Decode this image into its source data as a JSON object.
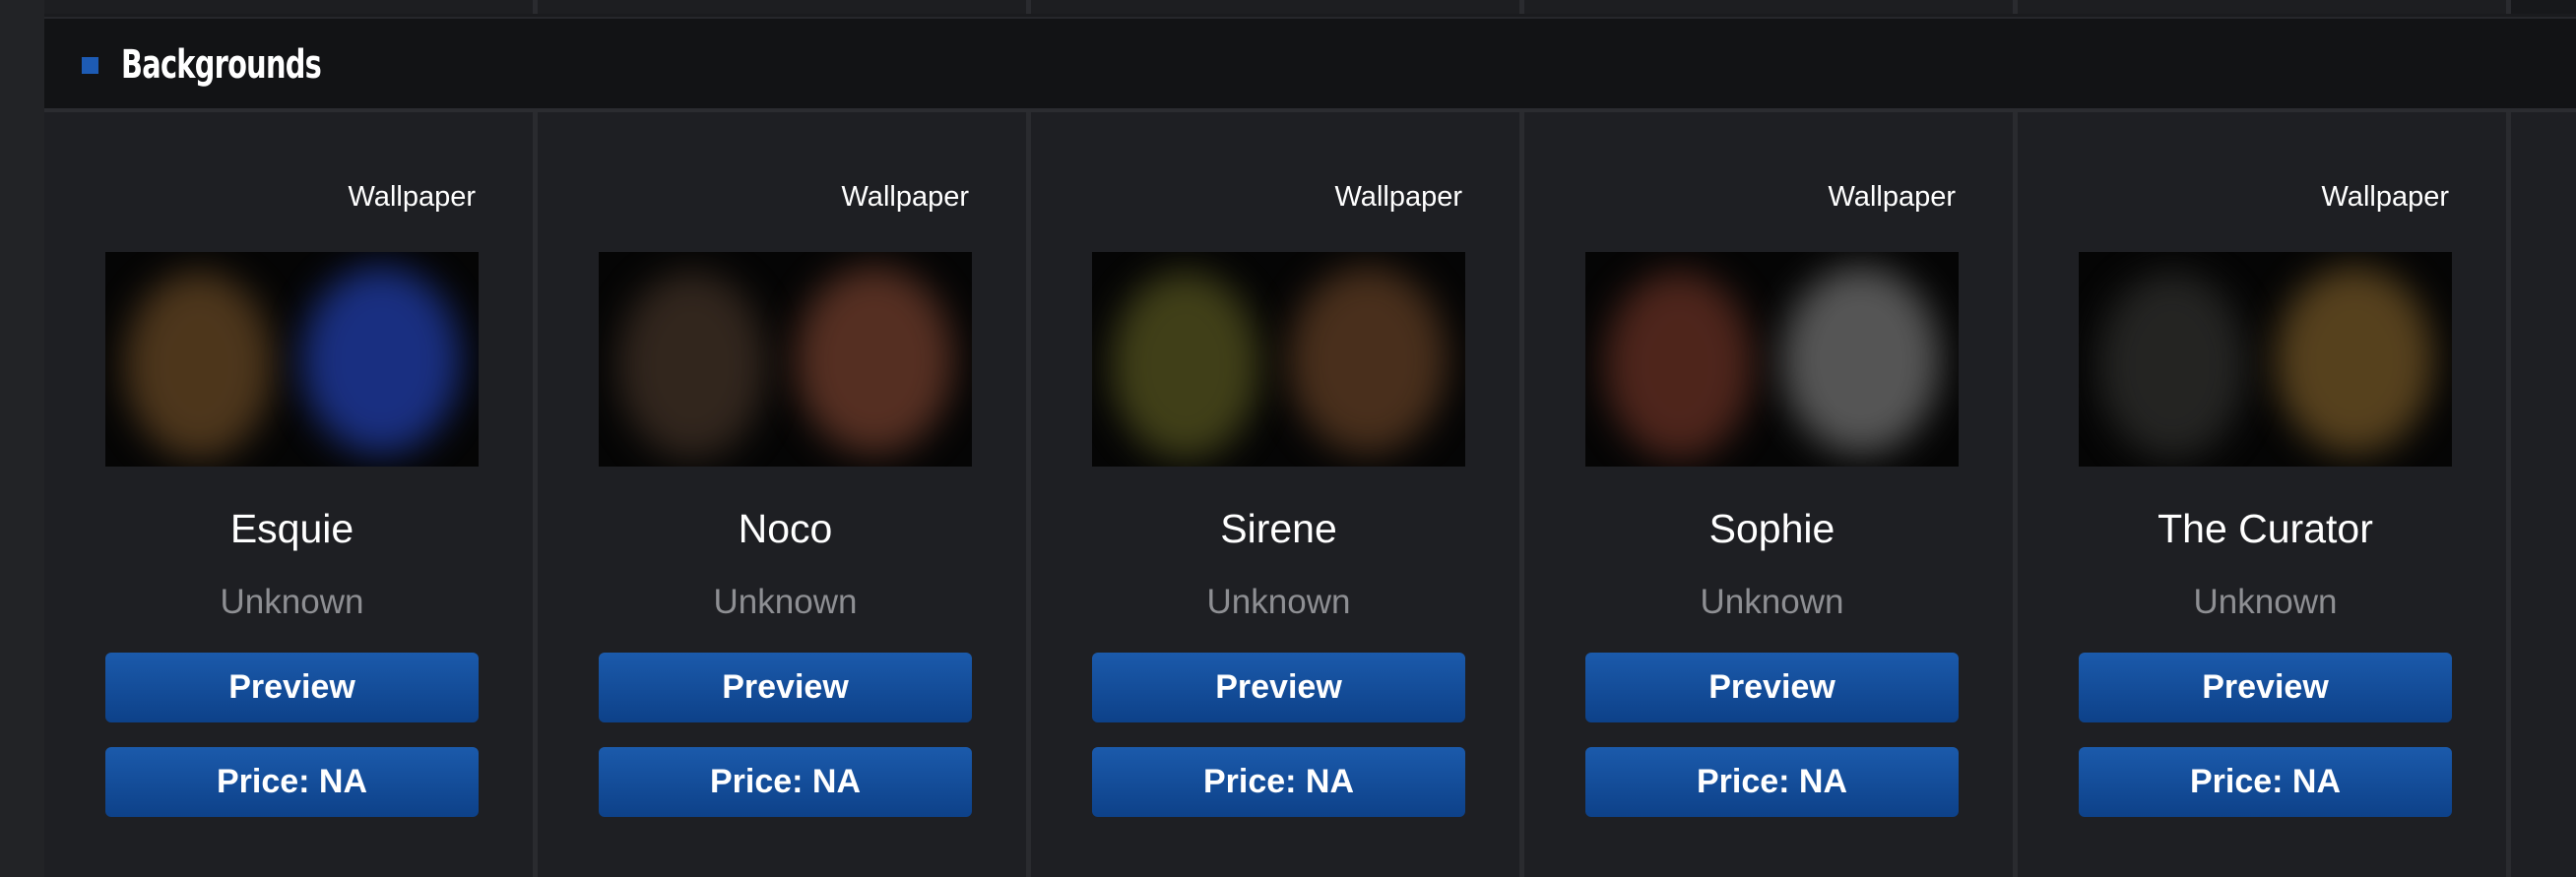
{
  "section": {
    "title": "Backgrounds",
    "accent_color": "#1d5bb4"
  },
  "items": [
    {
      "tag": "Wallpaper",
      "name": "Esquie",
      "status": "Unknown",
      "preview_label": "Preview",
      "price_label": "Price: NA",
      "tint_left": "#5a3f20",
      "tint_right": "#1f3aa0"
    },
    {
      "tag": "Wallpaper",
      "name": "Noco",
      "status": "Unknown",
      "preview_label": "Preview",
      "price_label": "Price: NA",
      "tint_left": "#3a2c22",
      "tint_right": "#6a3a2a"
    },
    {
      "tag": "Wallpaper",
      "name": "Sirene",
      "status": "Unknown",
      "preview_label": "Preview",
      "price_label": "Price: NA",
      "tint_left": "#4b4a1c",
      "tint_right": "#5a3a22"
    },
    {
      "tag": "Wallpaper",
      "name": "Sophie",
      "status": "Unknown",
      "preview_label": "Preview",
      "price_label": "Price: NA",
      "tint_left": "#5b2b20",
      "tint_right": "#6a6a6a"
    },
    {
      "tag": "Wallpaper",
      "name": "The Curator",
      "status": "Unknown",
      "preview_label": "Preview",
      "price_label": "Price: NA",
      "tint_left": "#2a2a28",
      "tint_right": "#6b5024"
    }
  ],
  "colors": {
    "button": "#0d4189",
    "background": "#1e1f23"
  }
}
